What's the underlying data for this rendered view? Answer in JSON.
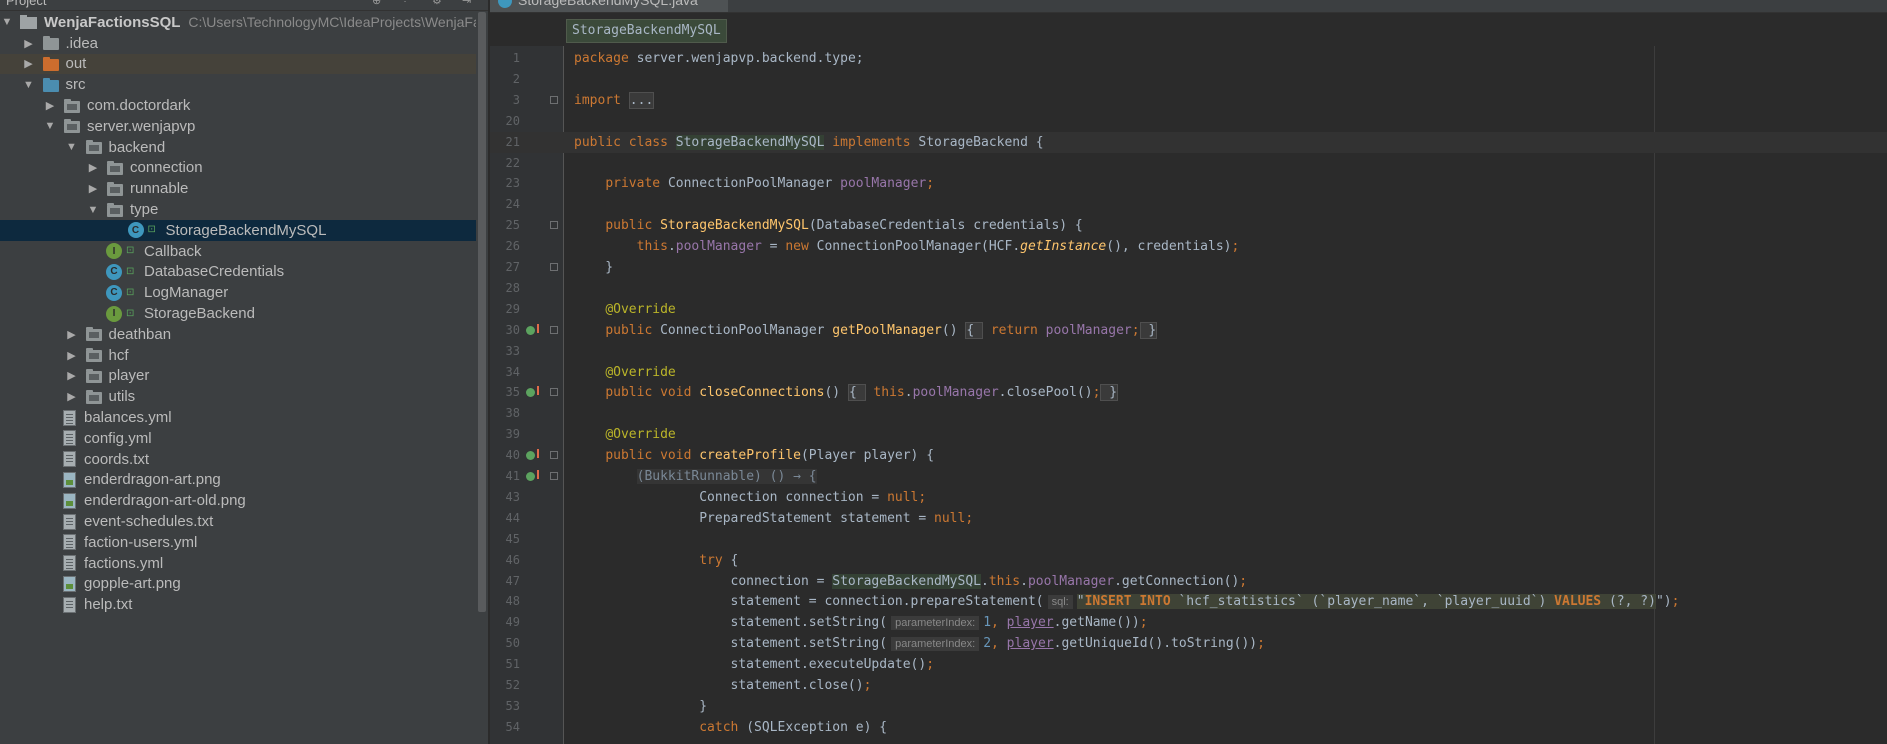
{
  "project_panel": {
    "header": {
      "title": "Project"
    },
    "tree": [
      {
        "label": "WenjaFactionsSQL",
        "path": "C:\\Users\\TechnologyMC\\IdeaProjects\\WenjaFac",
        "type": "project",
        "expanded": true,
        "depth": 0
      },
      {
        "label": ".idea",
        "type": "folder",
        "expanded": false,
        "depth": 1
      },
      {
        "label": "out",
        "type": "folder-orange",
        "expanded": false,
        "depth": 1
      },
      {
        "label": "src",
        "type": "folder-blue",
        "expanded": true,
        "depth": 1
      },
      {
        "label": "com.doctordark",
        "type": "package",
        "expanded": false,
        "depth": 2
      },
      {
        "label": "server.wenjapvp",
        "type": "package",
        "expanded": true,
        "depth": 2
      },
      {
        "label": "backend",
        "type": "package",
        "expanded": true,
        "depth": 3
      },
      {
        "label": "connection",
        "type": "package",
        "expanded": false,
        "depth": 4
      },
      {
        "label": "runnable",
        "type": "package",
        "expanded": false,
        "depth": 4
      },
      {
        "label": "type",
        "type": "package",
        "expanded": true,
        "depth": 4
      },
      {
        "label": "StorageBackendMySQL",
        "type": "class",
        "depth": 5,
        "selected": true
      },
      {
        "label": "Callback",
        "type": "interface",
        "depth": 4
      },
      {
        "label": "DatabaseCredentials",
        "type": "class",
        "depth": 4
      },
      {
        "label": "LogManager",
        "type": "class",
        "depth": 4
      },
      {
        "label": "StorageBackend",
        "type": "interface",
        "depth": 4
      },
      {
        "label": "deathban",
        "type": "package",
        "expanded": false,
        "depth": 3
      },
      {
        "label": "hcf",
        "type": "package",
        "expanded": false,
        "depth": 3
      },
      {
        "label": "player",
        "type": "package",
        "expanded": false,
        "depth": 3
      },
      {
        "label": "utils",
        "type": "package",
        "expanded": false,
        "depth": 3
      },
      {
        "label": "balances.yml",
        "type": "yml",
        "depth": 2
      },
      {
        "label": "config.yml",
        "type": "yml",
        "depth": 2
      },
      {
        "label": "coords.txt",
        "type": "txt",
        "depth": 2
      },
      {
        "label": "enderdragon-art.png",
        "type": "img",
        "depth": 2
      },
      {
        "label": "enderdragon-art-old.png",
        "type": "img",
        "depth": 2
      },
      {
        "label": "event-schedules.txt",
        "type": "txt",
        "depth": 2
      },
      {
        "label": "faction-users.yml",
        "type": "yml",
        "depth": 2
      },
      {
        "label": "factions.yml",
        "type": "yml",
        "depth": 2
      },
      {
        "label": "gopple-art.png",
        "type": "img",
        "depth": 2
      },
      {
        "label": "help.txt",
        "type": "txt",
        "depth": 2
      }
    ]
  },
  "editor": {
    "tab": {
      "label": "StorageBackendMySQL.java"
    },
    "breadcrumb": "StorageBackendMySQL",
    "lines": [
      {
        "n": "1",
        "tokens": [
          [
            "kw",
            "package "
          ],
          [
            "",
            "server.wenjapvp.backend.type;"
          ]
        ]
      },
      {
        "n": "2",
        "tokens": []
      },
      {
        "n": "3",
        "fold": true,
        "tokens": [
          [
            "kw",
            "import "
          ],
          [
            "fold-text",
            "..."
          ]
        ]
      },
      {
        "n": "20",
        "tokens": []
      },
      {
        "n": "21",
        "caret": true,
        "tokens": [
          [
            "kw",
            "public class "
          ],
          [
            "hl-class",
            "StorageBackendMySQL"
          ],
          [
            "kw",
            " implements "
          ],
          [
            "",
            "StorageBackend {"
          ]
        ]
      },
      {
        "n": "22",
        "tokens": []
      },
      {
        "n": "23",
        "tokens": [
          [
            "",
            "    "
          ],
          [
            "kw",
            "private "
          ],
          [
            "",
            "ConnectionPoolManager "
          ],
          [
            "fld",
            "poolManager"
          ],
          [
            "kw",
            ";"
          ]
        ]
      },
      {
        "n": "24",
        "tokens": []
      },
      {
        "n": "25",
        "fold": true,
        "tokens": [
          [
            "",
            "    "
          ],
          [
            "kw",
            "public "
          ],
          [
            "mth",
            "StorageBackendMySQL"
          ],
          [
            "",
            "(DatabaseCredentials credentials) {"
          ]
        ]
      },
      {
        "n": "26",
        "tokens": [
          [
            "",
            "        "
          ],
          [
            "kw",
            "this"
          ],
          [
            "",
            "."
          ],
          [
            "fld",
            "poolManager"
          ],
          [
            "",
            " = "
          ],
          [
            "kw",
            "new "
          ],
          [
            "",
            "ConnectionPoolManager(HCF."
          ],
          [
            "mth it",
            "getInstance"
          ],
          [
            "",
            "(), credentials)"
          ],
          [
            "kw",
            ";"
          ]
        ]
      },
      {
        "n": "27",
        "fold": true,
        "tokens": [
          [
            "",
            "    }"
          ]
        ]
      },
      {
        "n": "28",
        "tokens": []
      },
      {
        "n": "29",
        "tokens": [
          [
            "",
            "    "
          ],
          [
            "ann",
            "@Override"
          ]
        ]
      },
      {
        "n": "30",
        "mark": true,
        "fold": true,
        "tokens": [
          [
            "",
            "    "
          ],
          [
            "kw",
            "public "
          ],
          [
            "",
            "ConnectionPoolManager "
          ],
          [
            "mth",
            "getPoolManager"
          ],
          [
            "",
            "() "
          ],
          [
            "fold-text",
            "{ "
          ],
          [
            "kw",
            " return "
          ],
          [
            "fld",
            "poolManager"
          ],
          [
            "kw",
            ";"
          ],
          [
            "fold-text",
            " }"
          ]
        ]
      },
      {
        "n": "33",
        "tokens": []
      },
      {
        "n": "34",
        "tokens": [
          [
            "",
            "    "
          ],
          [
            "ann",
            "@Override"
          ]
        ]
      },
      {
        "n": "35",
        "mark": true,
        "fold": true,
        "tokens": [
          [
            "",
            "    "
          ],
          [
            "kw",
            "public void "
          ],
          [
            "mth",
            "closeConnections"
          ],
          [
            "",
            "() "
          ],
          [
            "fold-text",
            "{ "
          ],
          [
            "kw",
            " this"
          ],
          [
            "",
            "."
          ],
          [
            "fld",
            "poolManager"
          ],
          [
            "",
            ".closePool()"
          ],
          [
            "kw",
            ";"
          ],
          [
            "fold-text",
            " }"
          ]
        ]
      },
      {
        "n": "38",
        "tokens": []
      },
      {
        "n": "39",
        "tokens": [
          [
            "",
            "    "
          ],
          [
            "ann",
            "@Override"
          ]
        ]
      },
      {
        "n": "40",
        "mark": true,
        "fold": true,
        "tokens": [
          [
            "",
            "    "
          ],
          [
            "kw",
            "public void "
          ],
          [
            "mth",
            "createProfile"
          ],
          [
            "",
            "(Player player) {"
          ]
        ]
      },
      {
        "n": "41",
        "mark": true,
        "fold": true,
        "tokens": [
          [
            "",
            "        "
          ],
          [
            "lam",
            "(BukkitRunnable) () → {"
          ]
        ]
      },
      {
        "n": "43",
        "tokens": [
          [
            "",
            "                Connection connection = "
          ],
          [
            "kw",
            "null;"
          ]
        ]
      },
      {
        "n": "44",
        "tokens": [
          [
            "",
            "                PreparedStatement statement = "
          ],
          [
            "kw",
            "null;"
          ]
        ]
      },
      {
        "n": "45",
        "tokens": []
      },
      {
        "n": "46",
        "tokens": [
          [
            "",
            "                "
          ],
          [
            "kw",
            "try "
          ],
          [
            "",
            "{"
          ]
        ]
      },
      {
        "n": "47",
        "tokens": [
          [
            "",
            "                    connection = "
          ],
          [
            "hl-class",
            "StorageBackendMySQL"
          ],
          [
            "",
            "."
          ],
          [
            "kw",
            "this"
          ],
          [
            "",
            "."
          ],
          [
            "fld",
            "poolManager"
          ],
          [
            "",
            ".getConnection()"
          ],
          [
            "kw",
            ";"
          ]
        ]
      },
      {
        "n": "48",
        "tokens": [
          [
            "",
            "                    statement = connection.prepareStatement("
          ],
          [
            "ph",
            "sql:"
          ],
          [
            "sqlbg",
            "\""
          ],
          [
            "sqlkw sqlbg",
            "INSERT INTO"
          ],
          [
            "sqltx sqlbg",
            " `hcf_statistics` (`player_name`, `player_uuid`) "
          ],
          [
            "sqlkw sqlbg",
            "VALUES"
          ],
          [
            "sqltx sqlbg",
            " (?, ?)"
          ],
          [
            "",
            "\")"
          ],
          [
            "kw",
            ";"
          ]
        ]
      },
      {
        "n": "49",
        "tokens": [
          [
            "",
            "                    statement.setString("
          ],
          [
            "ph",
            "parameterIndex:"
          ],
          [
            "num",
            "1"
          ],
          [
            "kw",
            ", "
          ],
          [
            "var-u",
            "player"
          ],
          [
            "",
            ".getName())"
          ],
          [
            "kw",
            ";"
          ]
        ]
      },
      {
        "n": "50",
        "tokens": [
          [
            "",
            "                    statement.setString("
          ],
          [
            "ph",
            "parameterIndex:"
          ],
          [
            "num",
            "2"
          ],
          [
            "kw",
            ", "
          ],
          [
            "var-u",
            "player"
          ],
          [
            "",
            ".getUniqueId().toString())"
          ],
          [
            "kw",
            ";"
          ]
        ]
      },
      {
        "n": "51",
        "tokens": [
          [
            "",
            "                    statement.executeUpdate()"
          ],
          [
            "kw",
            ";"
          ]
        ]
      },
      {
        "n": "52",
        "tokens": [
          [
            "",
            "                    statement.close()"
          ],
          [
            "kw",
            ";"
          ]
        ]
      },
      {
        "n": "53",
        "tokens": [
          [
            "",
            "                }"
          ]
        ]
      },
      {
        "n": "54",
        "tokens": [
          [
            "",
            "                "
          ],
          [
            "kw",
            "catch "
          ],
          [
            "",
            "(SQLException e) {"
          ]
        ]
      }
    ]
  }
}
